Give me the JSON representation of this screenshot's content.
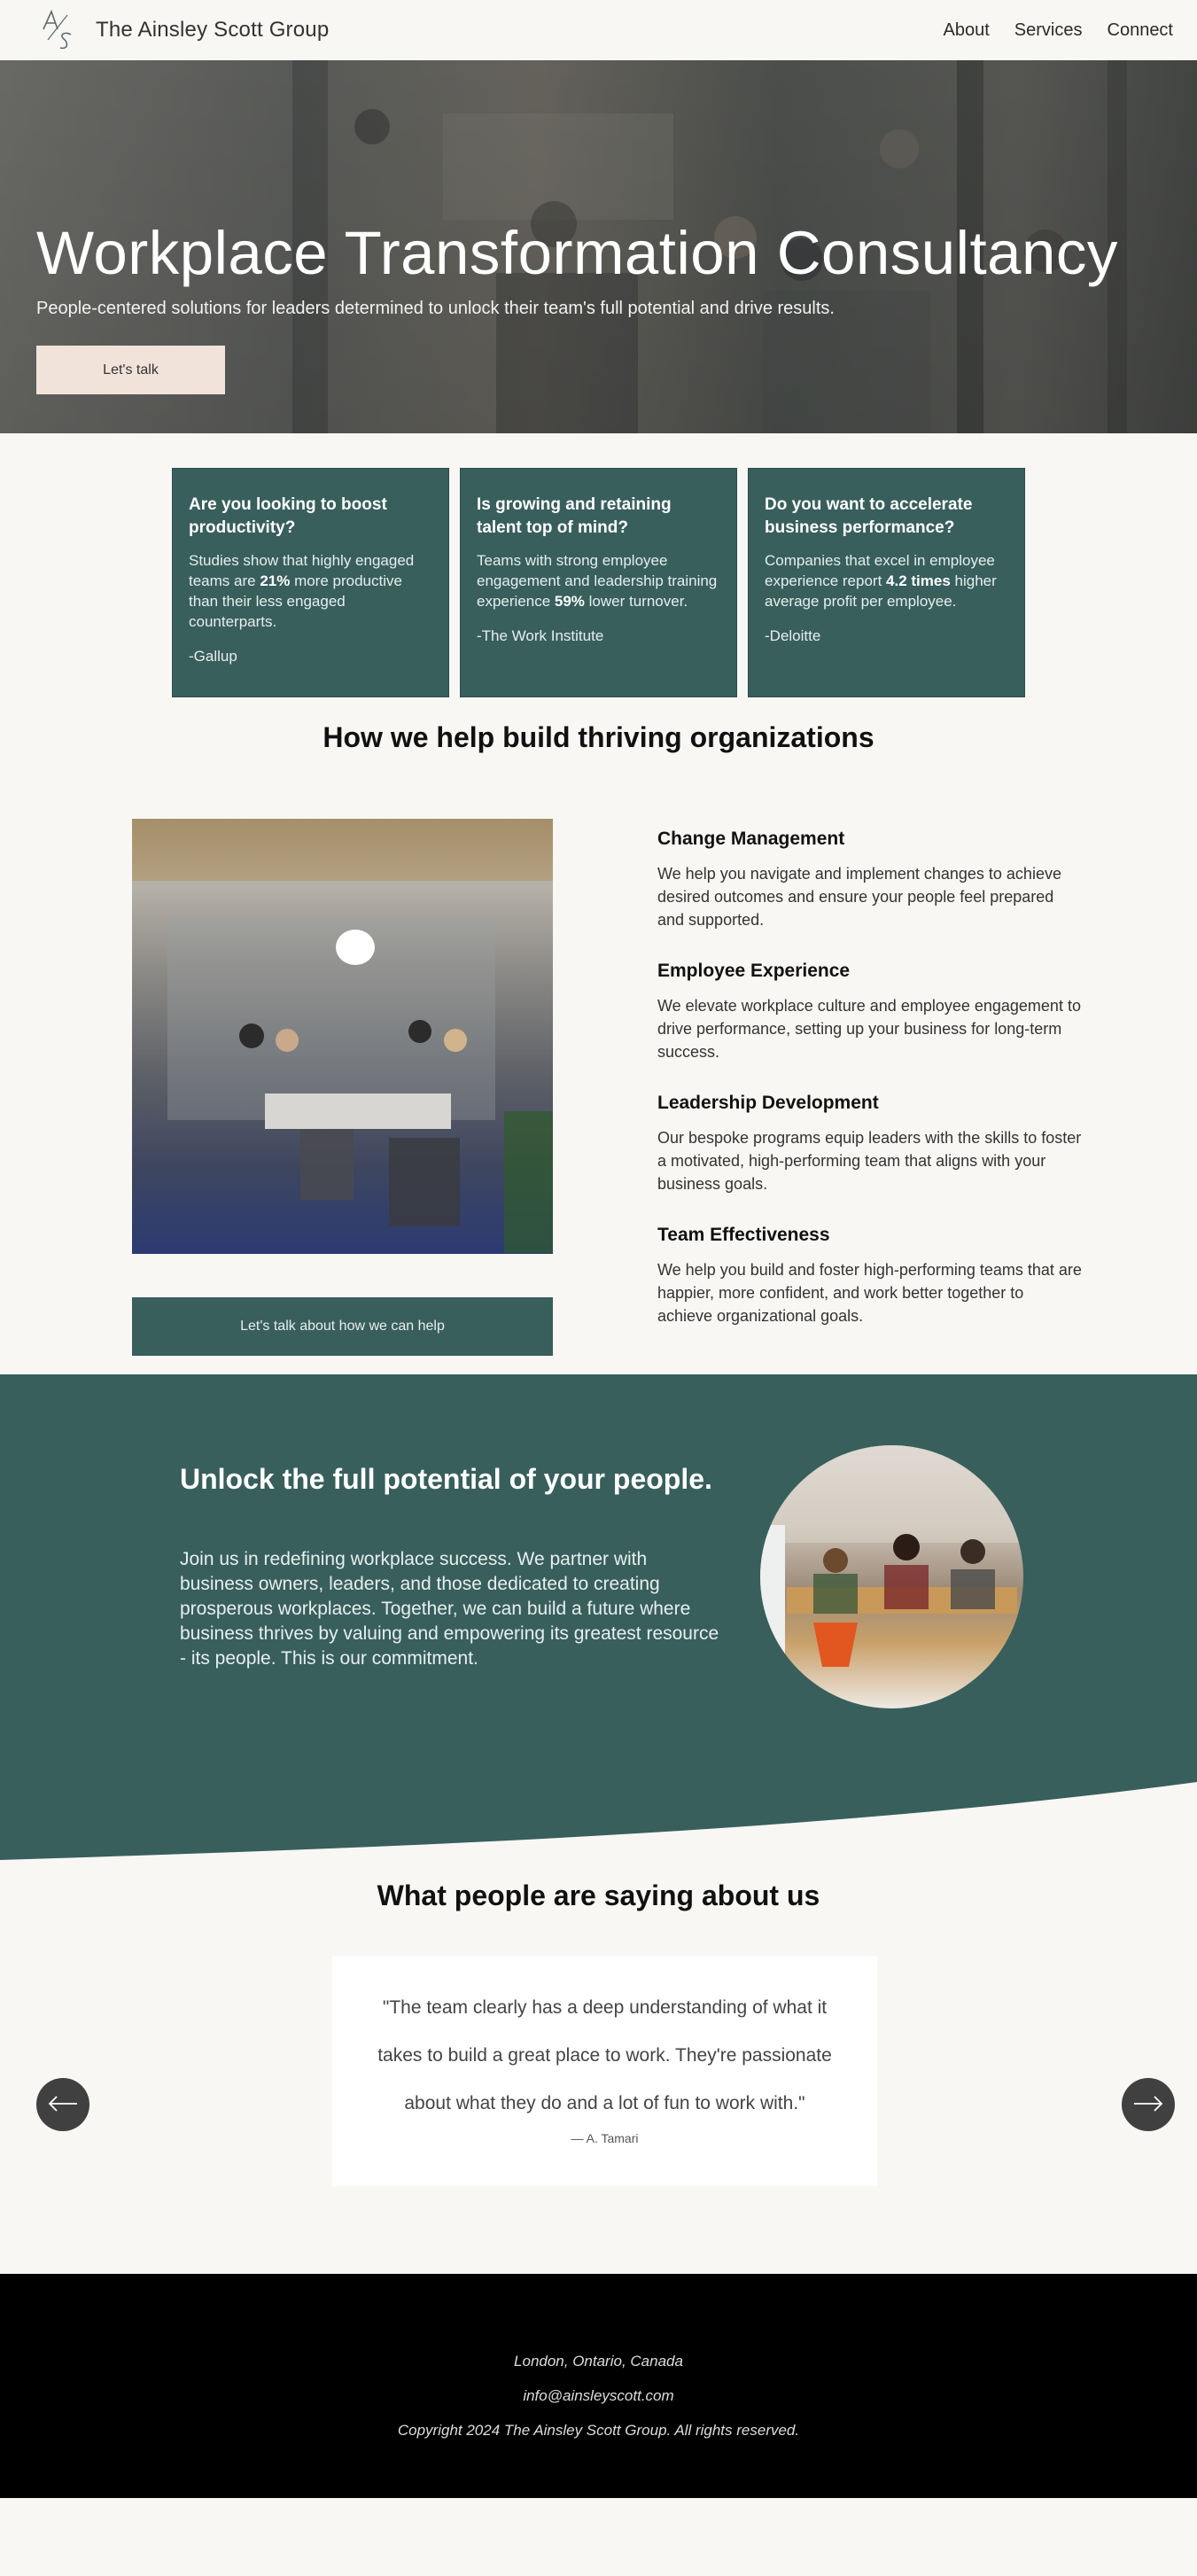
{
  "header": {
    "brand": "The Ainsley Scott Group",
    "nav": [
      "About",
      "Services",
      "Connect"
    ]
  },
  "hero": {
    "title": "Workplace Transformation Consultancy",
    "subtitle": "People-centered solutions for leaders determined to unlock their team's full potential and drive results.",
    "cta": "Let's talk"
  },
  "stats": [
    {
      "heading": "Are you looking to boost productivity?",
      "text_before": "Studies show that highly engaged teams are ",
      "highlight": "21%",
      "text_after": " more productive than their less engaged counterparts.",
      "source": "-Gallup"
    },
    {
      "heading": "Is growing and retaining talent top of mind?",
      "text_before": "Teams with strong employee engagement and leadership training experience ",
      "highlight": "59%",
      "text_after": " lower turnover.",
      "source": "-The Work Institute"
    },
    {
      "heading": "Do you want to accelerate business performance?",
      "text_before": "Companies that excel in employee experience report ",
      "highlight": "4.2 times",
      "text_after": " higher average profit per employee.",
      "source": "-Deloitte"
    }
  ],
  "help": {
    "title": "How we help build thriving organizations",
    "cta": "Let's talk about how we can help",
    "services": [
      {
        "title": "Change Management",
        "text": "We help you navigate and implement changes to achieve desired outcomes and ensure your people feel prepared and supported."
      },
      {
        "title": "Employee Experience",
        "text": "We elevate workplace culture and employee engagement to drive performance, setting up your business for long-term success."
      },
      {
        "title": "Leadership Development",
        "text": "Our bespoke programs equip leaders with the skills to foster a motivated, high-performing team that aligns with your business goals."
      },
      {
        "title": "Team Effectiveness",
        "text": "We help you build and foster high-performing teams that are happier, more confident, and work better together to achieve organizational goals."
      }
    ]
  },
  "unlock": {
    "title": "Unlock the full potential of your people.",
    "text": "Join us in redefining workplace success. We partner with business owners, leaders, and those dedicated to creating prosperous workplaces. Together, we can build a future where business thrives by valuing and empowering its greatest resource - its people. This is our commitment."
  },
  "testimonials": {
    "title": "What people are saying about us",
    "quote": "\"The team clearly has a deep understanding of what it takes to build a great place to work. They're passionate about what they do and a lot of fun to work with.\"",
    "author": "— A. Tamari"
  },
  "footer": {
    "location": "London, Ontario, Canada",
    "email": "info@ainsleyscott.com",
    "copyright": "Copyright 2024 The Ainsley Scott Group.  All rights reserved."
  },
  "colors": {
    "teal": "#385f5c",
    "cream": "#f8f7f4",
    "blush": "#f1e3da",
    "footer": "#000000"
  },
  "icons": [
    "logo-monogram-icon",
    "arrow-left-icon",
    "arrow-right-icon"
  ]
}
